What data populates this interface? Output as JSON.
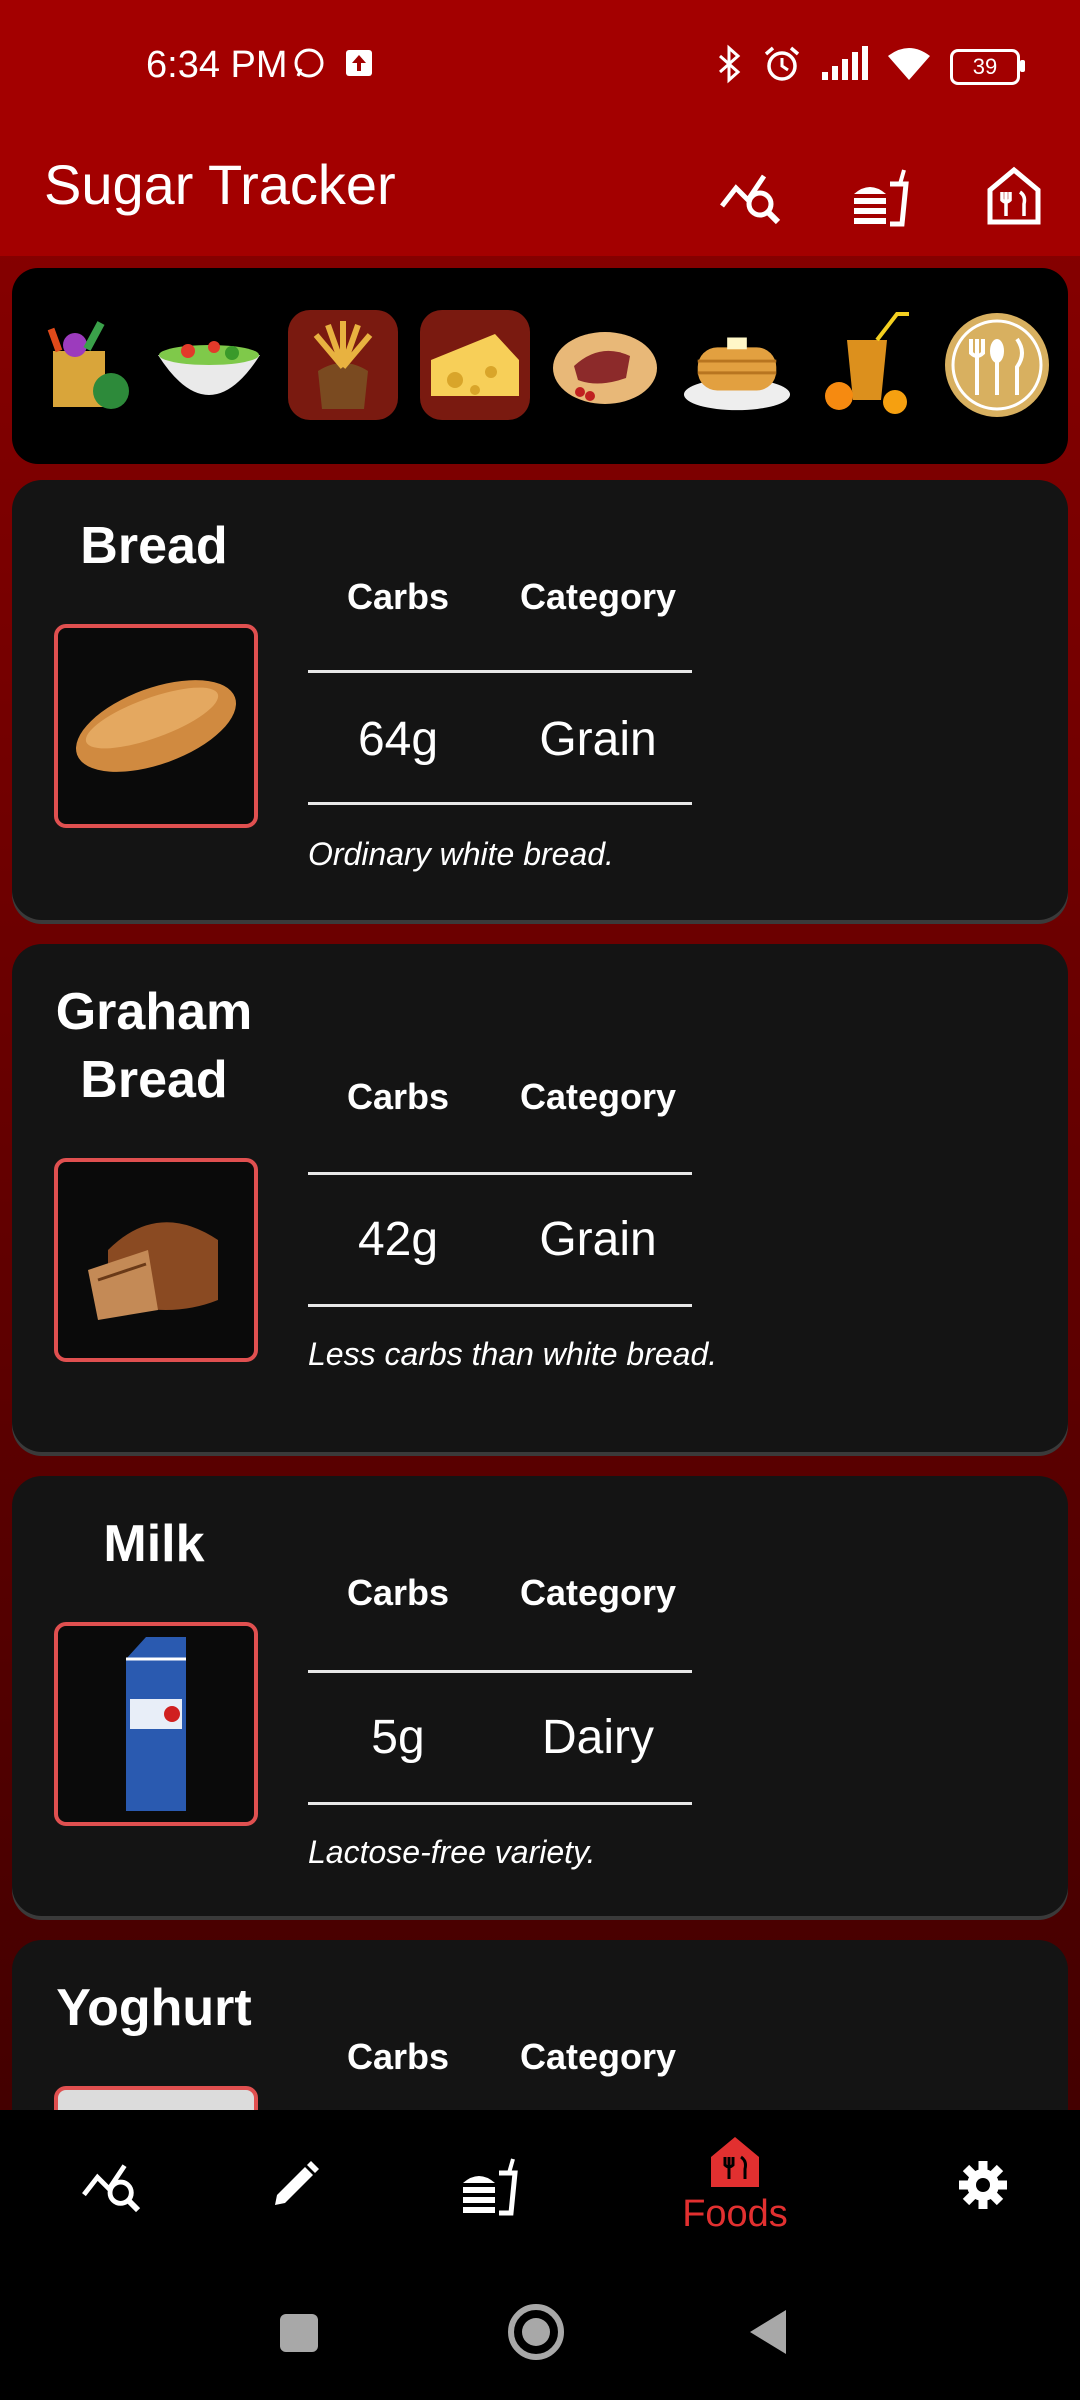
{
  "status_bar": {
    "time": "6:34 PM",
    "battery": "39",
    "icons": [
      "whatsapp-icon",
      "upload-icon",
      "bluetooth-icon",
      "alarm-icon",
      "signal-icon",
      "wifi-icon",
      "battery-icon"
    ]
  },
  "app_bar": {
    "title": "Sugar Tracker",
    "actions": [
      "analytics-icon",
      "meal-icon",
      "restaurant-icon"
    ]
  },
  "categories": [
    "groceries",
    "salad",
    "grain",
    "cheese",
    "meat",
    "pancakes",
    "juice",
    "cutlery"
  ],
  "selected_categories": [
    "grain",
    "cheese"
  ],
  "table_headers": {
    "carbs": "Carbs",
    "category": "Category"
  },
  "foods": [
    {
      "name": "Bread",
      "carbs": "64g",
      "category": "Grain",
      "note": "Ordinary white bread."
    },
    {
      "name": "Graham Bread",
      "carbs": "42g",
      "category": "Grain",
      "note": "Less carbs than white bread."
    },
    {
      "name": "Milk",
      "carbs": "5g",
      "category": "Dairy",
      "note": "Lactose-free variety."
    },
    {
      "name": "Yoghurt"
    }
  ],
  "bottom_nav": {
    "items": [
      "analytics-icon",
      "edit-icon",
      "meal-icon",
      "foods-icon",
      "settings-icon"
    ],
    "active_label": "Foods"
  },
  "colors": {
    "primary": "#a30000",
    "accent": "#e23030",
    "card": "#141414"
  }
}
